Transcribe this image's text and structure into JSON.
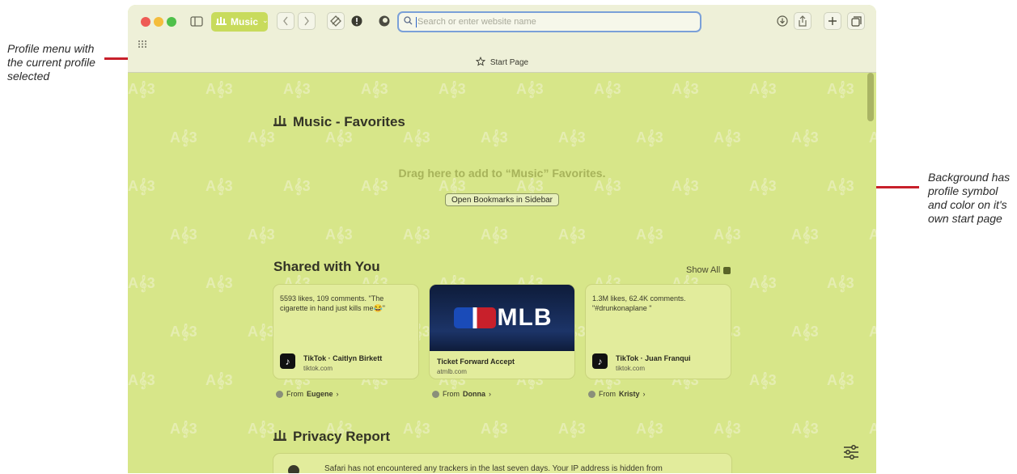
{
  "annotations": {
    "left": "Profile menu with the current profile selected",
    "right": "Background has profile symbol and color on it's own start page"
  },
  "toolbar": {
    "profile_name": "Music",
    "profile_chevron": "⌄",
    "url_placeholder": "Search or enter website name",
    "tab_title": "Start Page",
    "icons": [
      "sidebar-icon",
      "back-icon",
      "forward-icon",
      "privacy-icon",
      "alert-icon",
      "extension-icon",
      "search-icon",
      "download-icon",
      "share-icon",
      "new-tab-icon",
      "tab-overview-icon",
      "grid-icon"
    ]
  },
  "watermark": {
    "glyph": "A𝄞3"
  },
  "favorites": {
    "title": "Music - Favorites",
    "drag_hint": "Drag here to add to “Music” Favorites.",
    "open_bookmarks": "Open Bookmarks in Sidebar"
  },
  "shared": {
    "title": "Shared with You",
    "show_all": "Show All",
    "cards": [
      {
        "desc": "5593 likes, 109 comments. \"The cigarette in hand just kills me😂\"",
        "site": "TikTok · Caitlyn Birkett",
        "domain": "tiktok.com",
        "from_prefix": "From",
        "from_name": "Eugene"
      },
      {
        "desc": "",
        "site": "Ticket Forward Accept",
        "domain": "atmlb.com",
        "from_prefix": "From",
        "from_name": "Donna",
        "image_text": "MLB"
      },
      {
        "desc": "1.3M likes, 62.4K comments. \"#drunkonaplane \"",
        "site": "TikTok · Juan Franqui",
        "domain": "tiktok.com",
        "from_prefix": "From",
        "from_name": "Kristy"
      }
    ]
  },
  "privacy": {
    "title": "Privacy Report",
    "text": "Safari has not encountered any trackers in the last seven days. Your IP address is hidden from"
  },
  "colors": {
    "profile_bg": "#d7e689",
    "profile_accent": "#c8db5c",
    "annotation_line": "#c8202b"
  }
}
